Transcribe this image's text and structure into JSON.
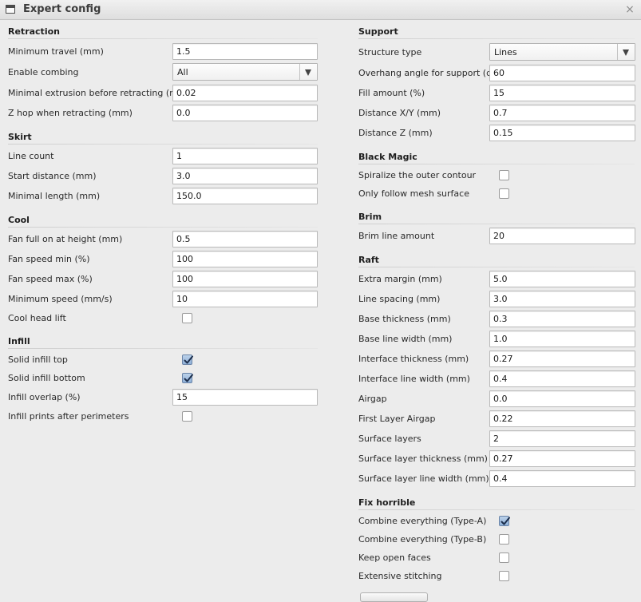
{
  "window": {
    "title": "Expert config",
    "close_glyph": "×",
    "icon": "window-icon"
  },
  "left": {
    "retraction": {
      "title": "Retraction",
      "minimum_travel": {
        "label": "Minimum travel (mm)",
        "value": "1.5"
      },
      "enable_combing": {
        "label": "Enable combing",
        "value": "All"
      },
      "minimal_extrusion": {
        "label": "Minimal extrusion before retracting (mm)",
        "value": "0.02"
      },
      "z_hop": {
        "label": "Z hop when retracting (mm)",
        "value": "0.0"
      }
    },
    "skirt": {
      "title": "Skirt",
      "line_count": {
        "label": "Line count",
        "value": "1"
      },
      "start_distance": {
        "label": "Start distance (mm)",
        "value": "3.0"
      },
      "minimal_length": {
        "label": "Minimal length (mm)",
        "value": "150.0"
      }
    },
    "cool": {
      "title": "Cool",
      "fan_full_on": {
        "label": "Fan full on at height (mm)",
        "value": "0.5"
      },
      "fan_speed_min": {
        "label": "Fan speed min (%)",
        "value": "100"
      },
      "fan_speed_max": {
        "label": "Fan speed max (%)",
        "value": "100"
      },
      "minimum_speed": {
        "label": "Minimum speed (mm/s)",
        "value": "10"
      },
      "cool_head_lift": {
        "label": "Cool head lift",
        "checked": false
      }
    },
    "infill": {
      "title": "Infill",
      "solid_top": {
        "label": "Solid infill top",
        "checked": true
      },
      "solid_bottom": {
        "label": "Solid infill bottom",
        "checked": true
      },
      "overlap": {
        "label": "Infill overlap (%)",
        "value": "15"
      },
      "after_perimeters": {
        "label": "Infill prints after perimeters",
        "checked": false
      }
    }
  },
  "right": {
    "support": {
      "title": "Support",
      "structure_type": {
        "label": "Structure type",
        "value": "Lines"
      },
      "overhang_angle": {
        "label": "Overhang angle for support (deg)",
        "value": "60"
      },
      "fill_amount": {
        "label": "Fill amount (%)",
        "value": "15"
      },
      "distance_xy": {
        "label": "Distance X/Y (mm)",
        "value": "0.7"
      },
      "distance_z": {
        "label": "Distance Z (mm)",
        "value": "0.15"
      }
    },
    "black_magic": {
      "title": "Black Magic",
      "spiralize": {
        "label": "Spiralize the outer contour",
        "checked": false
      },
      "only_mesh_surface": {
        "label": "Only follow mesh surface",
        "checked": false
      }
    },
    "brim": {
      "title": "Brim",
      "line_amount": {
        "label": "Brim line amount",
        "value": "20"
      }
    },
    "raft": {
      "title": "Raft",
      "extra_margin": {
        "label": "Extra margin (mm)",
        "value": "5.0"
      },
      "line_spacing": {
        "label": "Line spacing (mm)",
        "value": "3.0"
      },
      "base_thickness": {
        "label": "Base thickness (mm)",
        "value": "0.3"
      },
      "base_line_width": {
        "label": "Base line width (mm)",
        "value": "1.0"
      },
      "interface_thickness": {
        "label": "Interface thickness (mm)",
        "value": "0.27"
      },
      "interface_line_width": {
        "label": "Interface line width (mm)",
        "value": "0.4"
      },
      "airgap": {
        "label": "Airgap",
        "value": "0.0"
      },
      "first_layer_airgap": {
        "label": "First Layer Airgap",
        "value": "0.22"
      },
      "surface_layers": {
        "label": "Surface layers",
        "value": "2"
      },
      "surface_layer_thickness": {
        "label": "Surface layer thickness (mm)",
        "value": "0.27"
      },
      "surface_layer_line_width": {
        "label": "Surface layer line width (mm)",
        "value": "0.4"
      }
    },
    "fix_horrible": {
      "title": "Fix horrible",
      "combine_a": {
        "label": "Combine everything (Type-A)",
        "checked": true
      },
      "combine_b": {
        "label": "Combine everything (Type-B)",
        "checked": false
      },
      "keep_open_faces": {
        "label": "Keep open faces",
        "checked": false
      },
      "extensive_stitching": {
        "label": "Extensive stitching",
        "checked": false
      }
    }
  }
}
